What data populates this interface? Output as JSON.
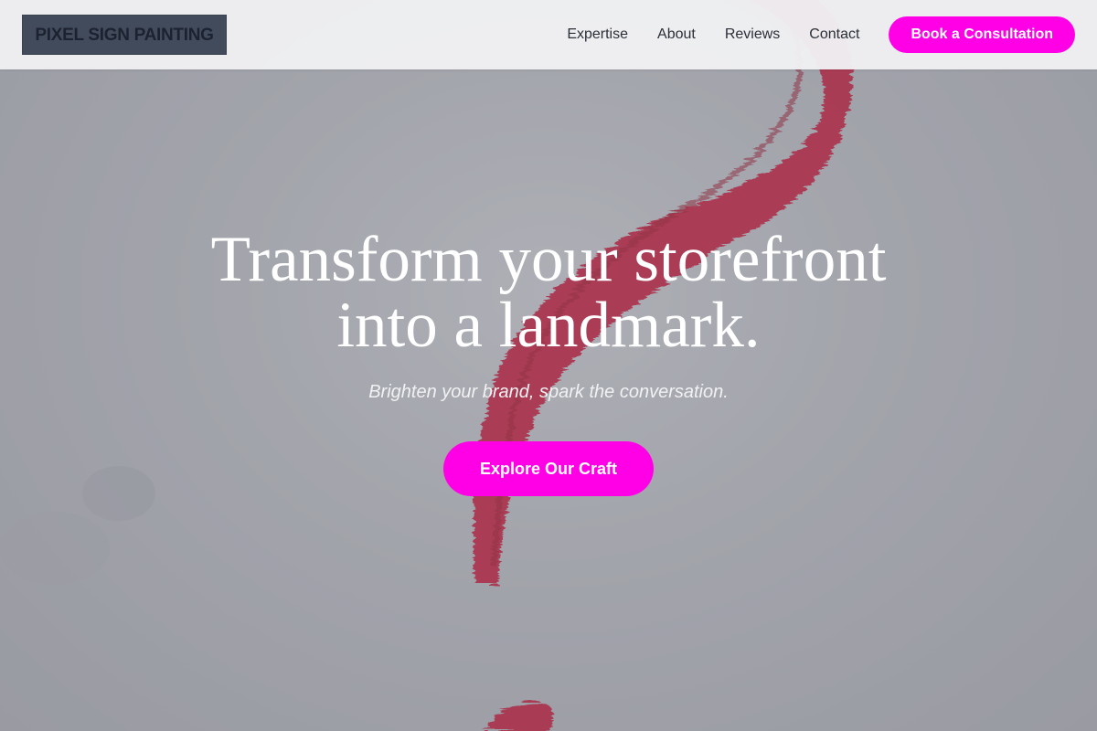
{
  "header": {
    "logo_text": "PIXEL SIGN PAINTING",
    "nav": [
      {
        "label": "Expertise"
      },
      {
        "label": "About"
      },
      {
        "label": "Reviews"
      },
      {
        "label": "Contact"
      }
    ],
    "cta_label": "Book a Consultation"
  },
  "hero": {
    "title_line1": "Transform your storefront",
    "title_line2": "into a landmark.",
    "subtitle": "Brighten your brand, spark the conversation.",
    "button_label": "Explore Our Craft",
    "background_image": "red-paint-brushstroke-on-grey-wall"
  },
  "colors": {
    "accent": "#ff00e6",
    "header_bg": "#f0f0f2",
    "logo_bg": "#424b5c",
    "brushstroke": "#b3102e",
    "hero_gray": "#a3a6ad"
  }
}
